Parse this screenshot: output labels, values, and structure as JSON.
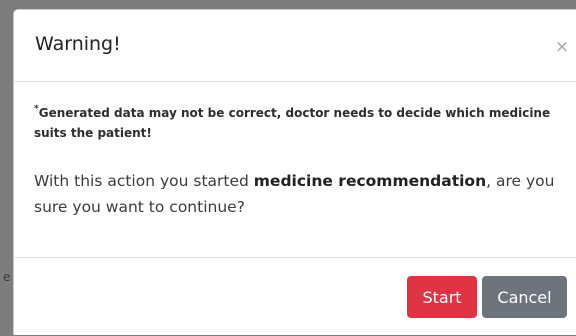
{
  "colors": {
    "start_button": "#e03444",
    "cancel_button": "#6c757d",
    "overlay": "#7d7d7d"
  },
  "backdrop": {
    "ghost_text": "e"
  },
  "modal": {
    "title": "Warning!",
    "close_label": "×",
    "disclaimer_marker": "*",
    "disclaimer": "Generated data may not be correct, doctor needs to decide which medicine suits the patient!",
    "message_before": "With this action you started ",
    "message_bold": "medicine recommendation",
    "message_after": ", are you sure you want to continue?",
    "buttons": {
      "start_label": "Start",
      "cancel_label": "Cancel"
    }
  }
}
